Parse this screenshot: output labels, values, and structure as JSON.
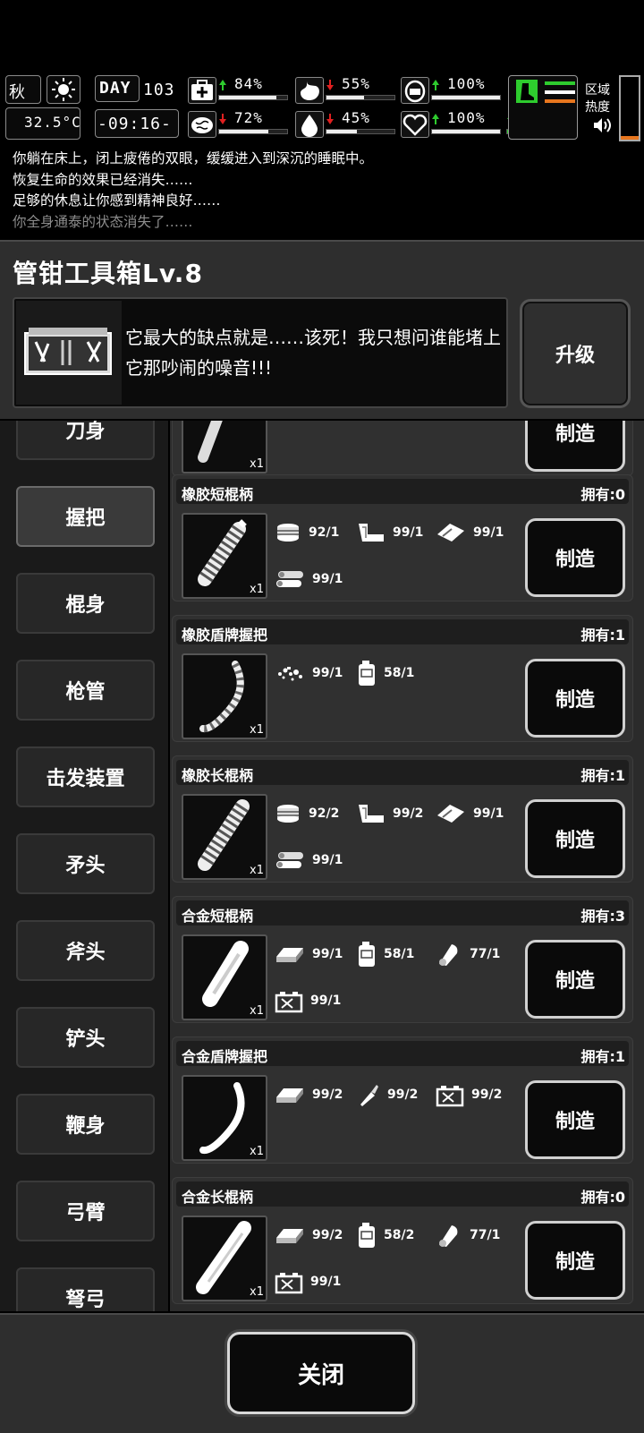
{
  "hud": {
    "season": "秋",
    "temperature": "32.5°C",
    "day_label": "DAY",
    "day": "103",
    "clock": "-09:16-",
    "stats": [
      {
        "icon": "health-icon",
        "dir": "up",
        "value": "84%",
        "fill": 0.84
      },
      {
        "icon": "stomach-icon",
        "dir": "down",
        "value": "55%",
        "fill": 0.55
      },
      {
        "icon": "bladder-icon",
        "dir": "up",
        "value": "100%",
        "fill": 1.0
      },
      {
        "icon": "brain-icon",
        "dir": "down",
        "value": "72%",
        "fill": 0.72
      },
      {
        "icon": "water-drop-icon",
        "dir": "down",
        "value": "45%",
        "fill": 0.45
      },
      {
        "icon": "heart-icon",
        "dir": "up",
        "value": "100%",
        "fill": 1.0
      },
      {
        "icon": "stamina-icon",
        "dir": "up",
        "value": "100%",
        "fill": 1.0
      }
    ],
    "region_heat_label": "区域热度"
  },
  "log": [
    "你躺在床上，闭上疲倦的双眼，缓缓进入到深沉的睡眠中。",
    "恢复生命的效果已经消失……",
    "足够的休息让你感到精神良好……",
    "你全身通泰的状态消失了……"
  ],
  "panel": {
    "title": "管钳工具箱Lv.8",
    "description": "它最大的缺点就是……该死！我只想问谁能堵上它那吵闹的噪音!!!",
    "upgrade_label": "升级"
  },
  "categories": [
    "刀身",
    "握把",
    "棍身",
    "枪管",
    "击发装置",
    "矛头",
    "斧头",
    "铲头",
    "鞭身",
    "弓臂",
    "弩弓"
  ],
  "active_category": 1,
  "partial_recipe": {
    "count": "x1",
    "craft_label": "制造"
  },
  "recipes": [
    {
      "name": "橡胶短棍柄",
      "owned": "拥有:0",
      "count": "x1",
      "craft_label": "制造",
      "materials": [
        {
          "icon": "rubber-roll-icon",
          "qty": "92/1"
        },
        {
          "icon": "pipe-icon",
          "qty": "99/1"
        },
        {
          "icon": "tape-icon",
          "qty": "99/1"
        },
        {
          "icon": "wood-logs-icon",
          "qty": "99/1"
        }
      ]
    },
    {
      "name": "橡胶盾牌握把",
      "owned": "拥有:1",
      "count": "x1",
      "craft_label": "制造",
      "materials": [
        {
          "icon": "scrap-pile-icon",
          "qty": "99/1"
        },
        {
          "icon": "jerrycan-icon",
          "qty": "58/1"
        }
      ]
    },
    {
      "name": "橡胶长棍柄",
      "owned": "拥有:1",
      "count": "x1",
      "craft_label": "制造",
      "materials": [
        {
          "icon": "rubber-roll-icon",
          "qty": "92/2"
        },
        {
          "icon": "pipe-icon",
          "qty": "99/2"
        },
        {
          "icon": "tape-icon",
          "qty": "99/1"
        },
        {
          "icon": "wood-logs-icon",
          "qty": "99/1"
        }
      ]
    },
    {
      "name": "合金短棍柄",
      "owned": "拥有:3",
      "count": "x1",
      "craft_label": "制造",
      "materials": [
        {
          "icon": "metal-ingot-icon",
          "qty": "99/1"
        },
        {
          "icon": "jerrycan-icon",
          "qty": "58/1"
        },
        {
          "icon": "cloth-roll-icon",
          "qty": "77/1"
        },
        {
          "icon": "battery-box-icon",
          "qty": "99/1"
        }
      ]
    },
    {
      "name": "合金盾牌握把",
      "owned": "拥有:1",
      "count": "x1",
      "craft_label": "制造",
      "materials": [
        {
          "icon": "metal-ingot-icon",
          "qty": "99/2"
        },
        {
          "icon": "glue-tube-icon",
          "qty": "99/2"
        },
        {
          "icon": "battery-box-icon",
          "qty": "99/2"
        }
      ]
    },
    {
      "name": "合金长棍柄",
      "owned": "拥有:0",
      "count": "x1",
      "craft_label": "制造",
      "materials": [
        {
          "icon": "metal-ingot-icon",
          "qty": "99/2"
        },
        {
          "icon": "jerrycan-icon",
          "qty": "58/2"
        },
        {
          "icon": "cloth-roll-icon",
          "qty": "77/1"
        },
        {
          "icon": "battery-box-icon",
          "qty": "99/1"
        }
      ]
    }
  ],
  "close_label": "关闭"
}
